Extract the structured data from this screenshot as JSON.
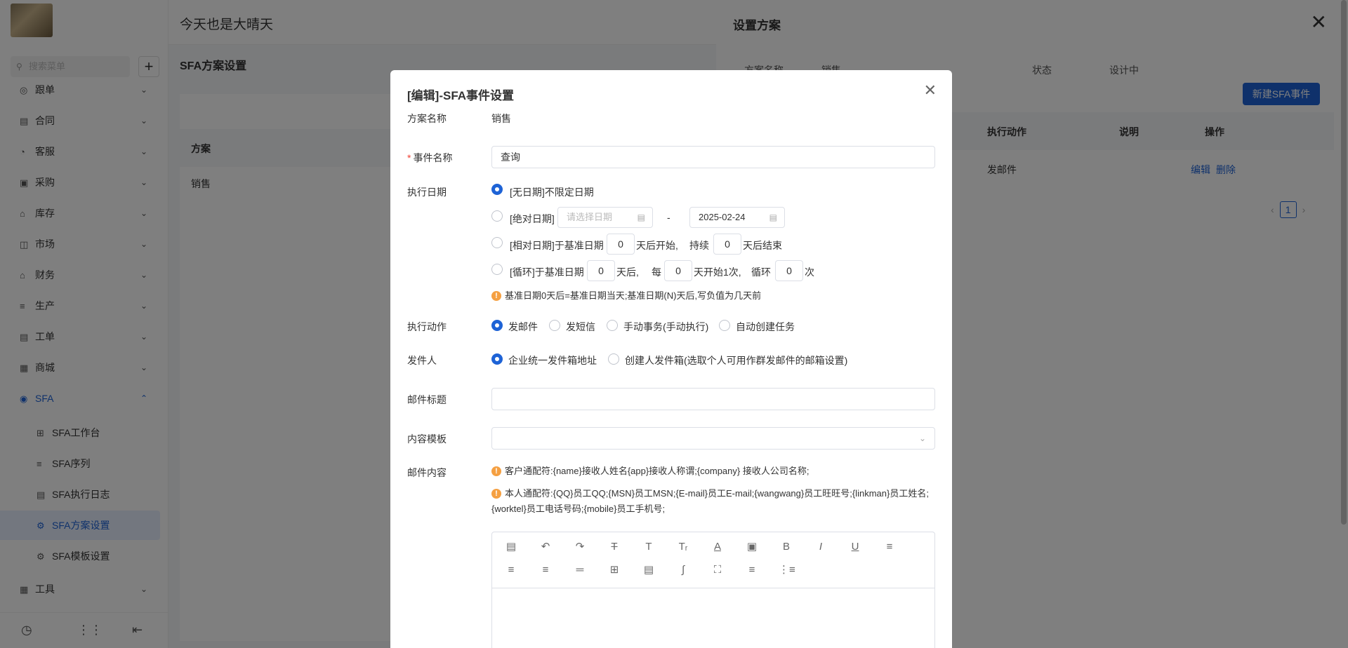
{
  "header": {
    "title": "今天也是大晴天"
  },
  "sidebar": {
    "search_placeholder": "搜索菜单",
    "items": [
      {
        "label": "跟单",
        "icon": "target-icon"
      },
      {
        "label": "合同",
        "icon": "contract-icon"
      },
      {
        "label": "客服",
        "icon": "headset-icon"
      },
      {
        "label": "采购",
        "icon": "purchase-icon"
      },
      {
        "label": "库存",
        "icon": "warehouse-icon"
      },
      {
        "label": "市场",
        "icon": "market-icon"
      },
      {
        "label": "财务",
        "icon": "finance-icon"
      },
      {
        "label": "生产",
        "icon": "production-icon"
      },
      {
        "label": "工单",
        "icon": "ticket-icon"
      },
      {
        "label": "商城",
        "icon": "store-icon"
      },
      {
        "label": "SFA",
        "icon": "sfa-icon"
      },
      {
        "label": "工具",
        "icon": "tool-icon"
      }
    ],
    "sfa_sub": [
      {
        "label": "SFA工作台"
      },
      {
        "label": "SFA序列"
      },
      {
        "label": "SFA执行日志"
      },
      {
        "label": "SFA方案设置"
      },
      {
        "label": "SFA模板设置"
      }
    ]
  },
  "page": {
    "title": "SFA方案设置",
    "table_header": "方案",
    "row_value": "销售"
  },
  "drawer": {
    "title": "设置方案",
    "fields": {
      "plan_name_label": "方案名称",
      "plan_name_value": "销售",
      "status_label": "状态",
      "status_value": "设计中"
    },
    "new_button": "新建SFA事件",
    "columns": {
      "action": "执行动作",
      "desc": "说明",
      "ops": "操作"
    },
    "row": {
      "action": "发邮件",
      "edit": "编辑",
      "delete": "删除"
    },
    "page_current": "1"
  },
  "modal": {
    "title": "[编辑]-SFA事件设置",
    "plan_name_label": "方案名称",
    "plan_name_value": "销售",
    "event_name_label": "事件名称",
    "event_name_value": "查询",
    "exec_date_label": "执行日期",
    "date_options": {
      "none": "[无日期]不限定日期",
      "absolute": "[绝对日期]",
      "abs_start_placeholder": "请选择日期",
      "abs_sep": "-",
      "abs_end_value": "2025-02-24",
      "relative_prefix": "[相对日期]于基准日期",
      "relative_after": "天后开始,",
      "relative_duration": "持续",
      "relative_end": "天后结束",
      "relative_start_val": "0",
      "relative_dur_val": "0",
      "cycle_prefix": "[循环]于基准日期",
      "cycle_after": "天后,",
      "cycle_every": "每",
      "cycle_every_suffix": "天开始1次,",
      "cycle_loop": "循环",
      "cycle_times": "次",
      "cycle_start_val": "0",
      "cycle_every_val": "0",
      "cycle_loop_val": "0"
    },
    "date_tip": "基准日期0天后=基准日期当天;基准日期(N)天后,写负值为几天前",
    "exec_action_label": "执行动作",
    "actions": [
      "发邮件",
      "发短信",
      "手动事务(手动执行)",
      "自动创建任务"
    ],
    "sender_label": "发件人",
    "senders": [
      "企业统一发件箱地址",
      "创建人发件箱(选取个人可用作群发邮件的邮箱设置)"
    ],
    "mail_subject_label": "邮件标题",
    "mail_subject_value": "",
    "template_label": "内容模板",
    "template_value": "",
    "mail_content_label": "邮件内容",
    "tip_customer": "客户通配符:{name}接收人姓名{app}接收人称谓;{company} 接收人公司名称;",
    "tip_self": "本人通配符:{QQ}员工QQ;{MSN}员工MSN;{E-mail}员工E-mail;{wangwang}员工旺旺号;{linkman}员工姓名;{worktel}员工电话号码;{mobile}员工手机号;",
    "toolbar": [
      "template-icon",
      "undo-icon",
      "redo-icon",
      "strikethrough-icon",
      "text-size-icon",
      "clear-format-icon",
      "font-color-icon",
      "background-color-icon",
      "bold-icon",
      "italic-icon",
      "underline-icon",
      "align-left-icon",
      "align-center-icon",
      "align-right-icon",
      "justify-icon",
      "table-icon",
      "image-icon",
      "attachment-icon",
      "fullscreen-icon",
      "ordered-list-icon",
      "unordered-list-icon"
    ]
  }
}
